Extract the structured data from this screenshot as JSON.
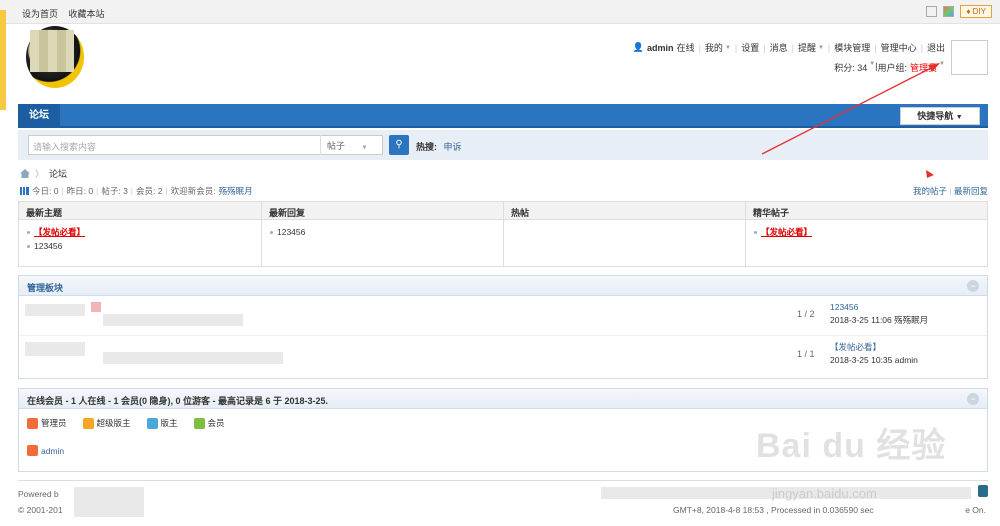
{
  "topbar": {
    "set_home": "设为首页",
    "bookmark": "收藏本站",
    "diy": "DIY"
  },
  "user": {
    "name": "admin",
    "online": "在线",
    "my": "我的",
    "settings": "设置",
    "messages": "消息",
    "remind": "提醒",
    "module_manage": "模块管理",
    "admin_center": "管理中心",
    "logout": "退出",
    "points": "积分: 34",
    "usergroup_label": "用户组:",
    "usergroup": "管理员"
  },
  "nav": {
    "tab": "论坛",
    "quick_nav": "快捷导航"
  },
  "search": {
    "placeholder": "请输入搜索内容",
    "type": "帖子",
    "hot_label": "热搜:",
    "hot_item": "申诉"
  },
  "breadcrumb": {
    "current": "论坛"
  },
  "stats": {
    "today": "今日: 0",
    "yesterday": "昨日: 0",
    "posts": "帖子: 3",
    "members": "会员: 2",
    "welcome": "欢迎新会员:",
    "newest": "殇殇眠月"
  },
  "links": {
    "my_posts": "我的帖子",
    "latest_replies": "最新回复"
  },
  "grid": {
    "h1": "最新主题",
    "h2": "最新回复",
    "h3": "热帖",
    "h4": "精华帖子",
    "c1a": "【发帖必看】",
    "c1b": "123456",
    "c2a": "123456",
    "c4a": "【发帖必看】"
  },
  "category": {
    "title": "管理板块"
  },
  "forums": [
    {
      "count": "1 / 2",
      "last_title": "123456",
      "last_meta": "2018-3-25 11:06 殇殇眠月"
    },
    {
      "count": "1 / 1",
      "last_title": "【发帖必看】",
      "last_meta": "2018-3-25 10:35 admin"
    }
  ],
  "online": {
    "title": "在线会员 - 1 人在线 - 1 会员(0 隐身), 0 位游客 - 最高记录是 6 于 2018-3-25.",
    "groups": [
      "管理员",
      "超级版主",
      "版主",
      "会员"
    ],
    "user": "admin"
  },
  "footer": {
    "powered": "Powered b",
    "copyright": "© 2001-201",
    "time": "GMT+8, 2018-4-8 18:53 , Processed in 0.036590 sec",
    "tail": "e On."
  },
  "watermark": {
    "main": "Bai du 经验",
    "url": "jingyan.baidu.com"
  },
  "colors": {
    "accent": "#2b75c0",
    "red": "#e00000"
  }
}
